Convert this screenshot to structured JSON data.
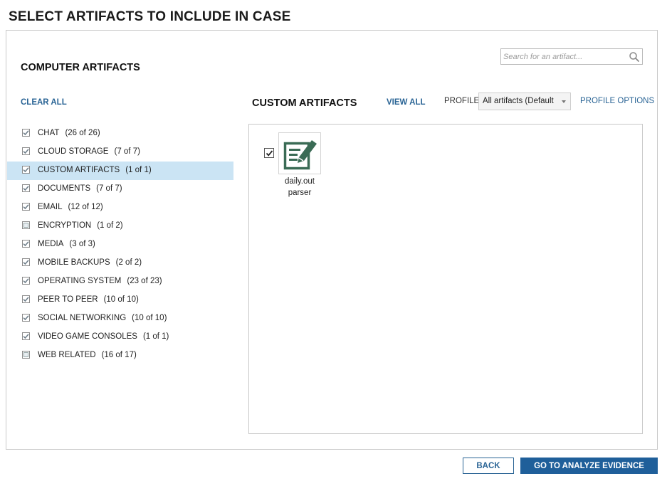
{
  "page": {
    "title": "SELECT ARTIFACTS TO INCLUDE IN CASE"
  },
  "search": {
    "placeholder": "Search for an artifact..."
  },
  "left_panel": {
    "title": "COMPUTER ARTIFACTS",
    "clear_all_label": "CLEAR ALL",
    "categories": [
      {
        "label": "CHAT",
        "count": "(26 of 26)",
        "checked": true
      },
      {
        "label": "CLOUD STORAGE",
        "count": "(7 of 7)",
        "checked": true
      },
      {
        "label": "CUSTOM ARTIFACTS",
        "count": "(1 of 1)",
        "checked": true,
        "selected": true
      },
      {
        "label": "DOCUMENTS",
        "count": "(7 of 7)",
        "checked": true
      },
      {
        "label": "EMAIL",
        "count": "(12 of 12)",
        "checked": true
      },
      {
        "label": "ENCRYPTION",
        "count": "(1 of 2)",
        "checked": false
      },
      {
        "label": "MEDIA",
        "count": "(3 of 3)",
        "checked": true
      },
      {
        "label": "MOBILE BACKUPS",
        "count": "(2 of 2)",
        "checked": true
      },
      {
        "label": "OPERATING SYSTEM",
        "count": "(23 of 23)",
        "checked": true
      },
      {
        "label": "PEER TO PEER",
        "count": "(10 of 10)",
        "checked": true
      },
      {
        "label": "SOCIAL NETWORKING",
        "count": "(10 of 10)",
        "checked": true
      },
      {
        "label": "VIDEO GAME CONSOLES",
        "count": "(1 of 1)",
        "checked": true
      },
      {
        "label": "WEB RELATED",
        "count": "(16 of 17)",
        "checked": false
      }
    ]
  },
  "right_panel": {
    "title": "CUSTOM ARTIFACTS",
    "view_all_label": "VIEW ALL",
    "profile_label": "PROFILE",
    "profile_value": "All artifacts (Default",
    "profile_options_label": "PROFILE OPTIONS",
    "artifacts": [
      {
        "name_line1": "daily.out",
        "name_line2": "parser",
        "icon": "edit-document-icon",
        "checked": true
      }
    ]
  },
  "footer": {
    "back_label": "BACK",
    "go_label": "GO TO ANALYZE EVIDENCE"
  },
  "colors": {
    "accent": "#2a6495",
    "primary_button": "#1f5f9a",
    "selected_row": "#cbe4f4",
    "icon_green": "#3a6b55"
  }
}
